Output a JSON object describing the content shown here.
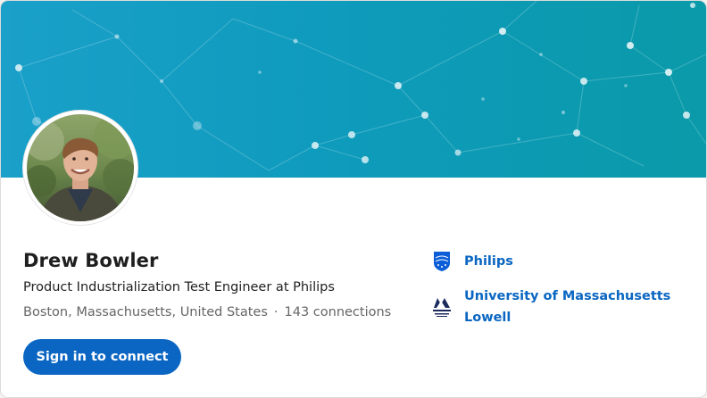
{
  "profile": {
    "name": "Drew Bowler",
    "headline": "Product Industrialization Test Engineer at Philips",
    "location": "Boston, Massachusetts, United States",
    "separator": "·",
    "connections": "143 connections"
  },
  "actions": {
    "connect_label": "Sign in to connect"
  },
  "experience": [
    {
      "label": "Philips",
      "icon": "philips-logo-icon"
    },
    {
      "label": "University of Massachusetts Lowell",
      "icon": "umass-lowell-logo-icon"
    }
  ],
  "colors": {
    "accent": "#0a66c2",
    "banner_start": "#1aa0c9",
    "banner_end": "#0a9aa9",
    "text_primary": "#1f1f1f",
    "text_secondary": "#666666"
  }
}
